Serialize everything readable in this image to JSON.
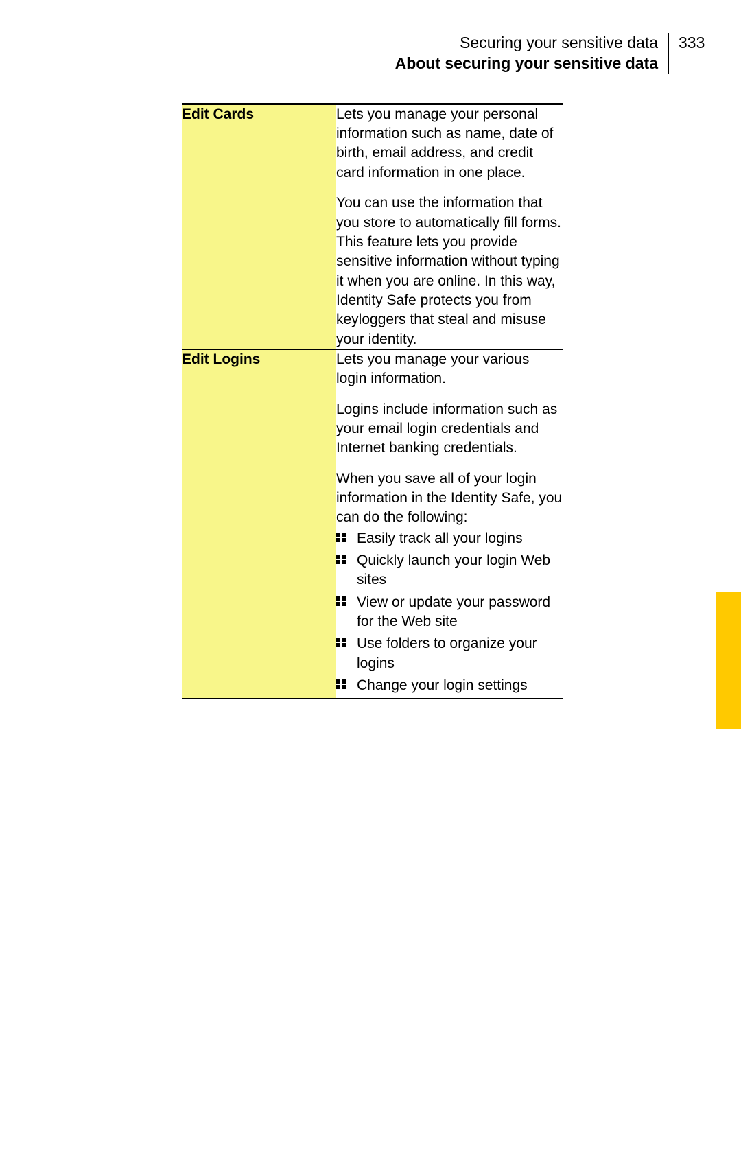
{
  "header": {
    "chapter": "Securing your sensitive data",
    "section": "About securing your sensitive data",
    "page_number": "333"
  },
  "rows": [
    {
      "title": "Edit Cards",
      "paras": [
        "Lets you manage your personal information such as name, date of birth, email address, and credit card information in one place.",
        "You can use the information that you store to automatically fill forms. This feature lets you provide sensitive information without typing it when you are online. In this way, Identity Safe protects you from keyloggers that steal and misuse your identity."
      ],
      "lead_in": null,
      "bullets": []
    },
    {
      "title": "Edit Logins",
      "paras": [
        "Lets you manage your various login information.",
        "Logins include information such as your email login credentials and Internet banking credentials."
      ],
      "lead_in": "When you save all of your login information in the Identity Safe, you can do the following:",
      "bullets": [
        "Easily track all your logins",
        "Quickly launch your login Web sites",
        "View or update your password for the Web site",
        "Use folders to organize your logins",
        "Change your login settings"
      ]
    }
  ]
}
